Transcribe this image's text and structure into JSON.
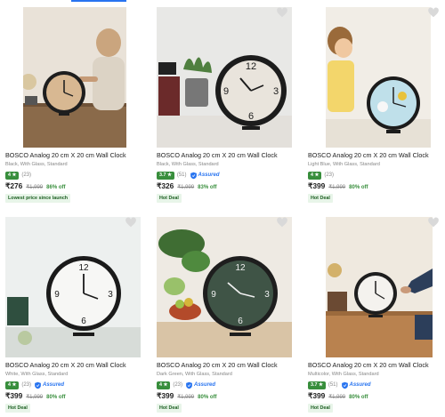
{
  "colors": {
    "accent": "#2874f0",
    "rating_green": "#388e3c",
    "discount_green": "#388e3c",
    "tag_bg": "#e8f5e9"
  },
  "products": [
    {
      "title": "BOSCO Analog 20 cm X 20 cm Wall Clock",
      "subtitle": "Black, With Glass, Standard",
      "rating": "4 ★",
      "count": "(23)",
      "assured": false,
      "price": "₹276",
      "mrp": "₹1,999",
      "off": "86% off",
      "tag": "Lowest price since launch"
    },
    {
      "title": "BOSCO Analog 20 cm X 20 cm Wall Clock",
      "subtitle": "Black, With Glass, Standard",
      "rating": "3.7 ★",
      "count": "(51)",
      "assured": true,
      "price": "₹326",
      "mrp": "₹1,999",
      "off": "83% off",
      "tag": "Hot Deal"
    },
    {
      "title": "BOSCO Analog 20 cm X 20 cm Wall Clock",
      "subtitle": "Light Blue, With Glass, Standard",
      "rating": "4 ★",
      "count": "(23)",
      "assured": false,
      "price": "₹399",
      "mrp": "₹1,999",
      "off": "80% off",
      "tag": "Hot Deal"
    },
    {
      "title": "BOSCO Analog 20 cm X 20 cm Wall Clock",
      "subtitle": "White, With Glass, Standard",
      "rating": "4 ★",
      "count": "(23)",
      "assured": true,
      "price": "₹399",
      "mrp": "₹1,999",
      "off": "80% off",
      "tag": "Hot Deal"
    },
    {
      "title": "BOSCO Analog 20 cm X 20 cm Wall Clock",
      "subtitle": "Dark Green, With Glass, Standard",
      "rating": "4 ★",
      "count": "(23)",
      "assured": true,
      "price": "₹399",
      "mrp": "₹1,999",
      "off": "80% off",
      "tag": "Hot Deal"
    },
    {
      "title": "BOSCO Analog 20 cm X 20 cm Wall Clock",
      "subtitle": "Multicolor, With Glass, Standard",
      "rating": "3.7 ★",
      "count": "(51)",
      "assured": true,
      "price": "₹399",
      "mrp": "₹1,999",
      "off": "80% off",
      "tag": "Hot Deal"
    }
  ],
  "assured_label": "Assured"
}
